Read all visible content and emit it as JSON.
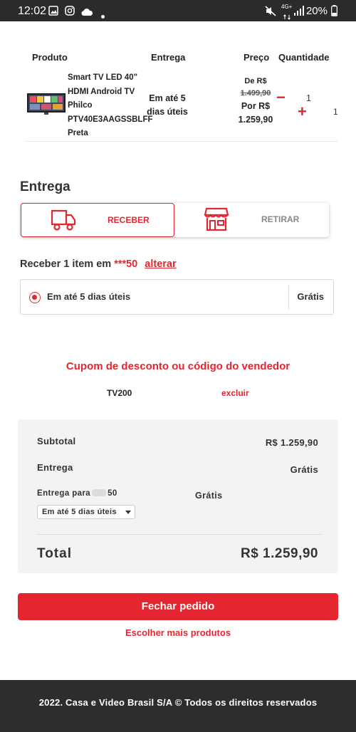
{
  "status_bar": {
    "time": "12:02",
    "network": "4G+",
    "battery": "20%",
    "icons": [
      "image-icon",
      "instagram-icon",
      "cloud-icon",
      "dot-icon",
      "mute-icon",
      "signal-icon",
      "battery-icon"
    ]
  },
  "cart_table": {
    "headers": {
      "product": "Produto",
      "delivery": "Entrega",
      "price": "Preço",
      "quantity": "Quantidade"
    },
    "item": {
      "name": "Smart TV LED 40\" HDMI Android TV Philco PTV40E3AAGSSBLFF Preta",
      "delivery": "Em até 5 dias úteis",
      "price_from_label": "De R$",
      "price_old": "1.499,90",
      "price_now_label": "Por R$",
      "price_now": "1.259,90",
      "quantity": "1",
      "quantity_clipped": "1",
      "minus_symbol": "−",
      "plus_symbol": "+"
    }
  },
  "shipping": {
    "title": "Entrega",
    "options": {
      "receive": "RECEBER",
      "pickup": "RETIRAR"
    },
    "receive_prefix": "Receber 1 item em",
    "cep_masked": "***50",
    "change_link": "alterar",
    "selected_option": {
      "label": "Em até 5 dias úteis",
      "price": "Grátis"
    }
  },
  "coupon": {
    "title": "Cupom de desconto ou código do vendedor",
    "code": "TV200",
    "remove_link": "excluir"
  },
  "summary": {
    "subtotal_label": "Subtotal",
    "subtotal_value": "R$ 1.259,90",
    "shipping_label": "Entrega",
    "shipping_value": "Grátis",
    "shipping_to_label": "Entrega para",
    "shipping_to_cep_end": "50",
    "shipping_to_value": "Grátis",
    "shipping_select": "Em até 5 dias úteis",
    "total_label": "Total",
    "total_value": "R$ 1.259,90"
  },
  "actions": {
    "checkout": "Fechar pedido",
    "more_products": "Escolher mais produtos"
  },
  "footer": {
    "text": "2022. Casa e Video Brasil S/A © Todos os direitos reservados"
  },
  "colors": {
    "accent": "#e3262f",
    "status_bar": "#2b2b2b",
    "footer": "#2d2d2d",
    "summary_bg": "#f3f3f3"
  }
}
